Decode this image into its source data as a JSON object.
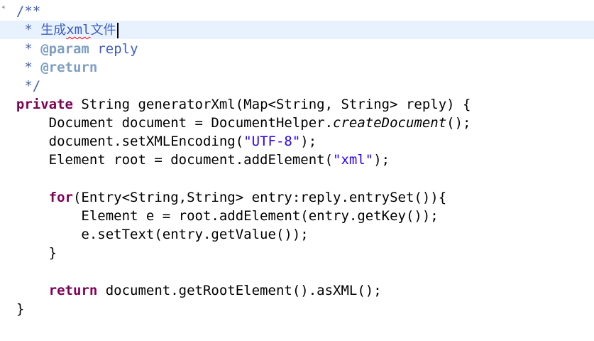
{
  "javadoc": {
    "open": "/**",
    "star": "*",
    "summary_prefix": "生成",
    "summary_spell": "xml",
    "summary_suffix": "文件",
    "param_tag": "@param",
    "param_name": "reply",
    "return_tag": "@return",
    "close": "*/"
  },
  "code": {
    "kw_private": "private",
    "signature": " String generatorXml(Map<String, String> reply) {",
    "line_doc_a": "    Document document = DocumentHelper.",
    "line_doc_method": "createDocument",
    "line_doc_b": "();",
    "line_enc_a": "    document.setXMLEncoding(",
    "line_enc_str": "\"UTF-8\"",
    "line_enc_b": ");",
    "line_root_a": "    Element root = document.addElement(",
    "line_root_str": "\"xml\"",
    "line_root_b": ");",
    "kw_for": "for",
    "line_for_rest": "(Entry<String,String> entry:reply.entrySet()){",
    "line_elem": "        Element e = root.addElement(entry.getKey());",
    "line_settext": "        e.setText(entry.getValue());",
    "line_close_for": "    }",
    "kw_return": "return",
    "line_return_rest": " document.getRootElement().asXML();",
    "line_close_method": "}"
  }
}
